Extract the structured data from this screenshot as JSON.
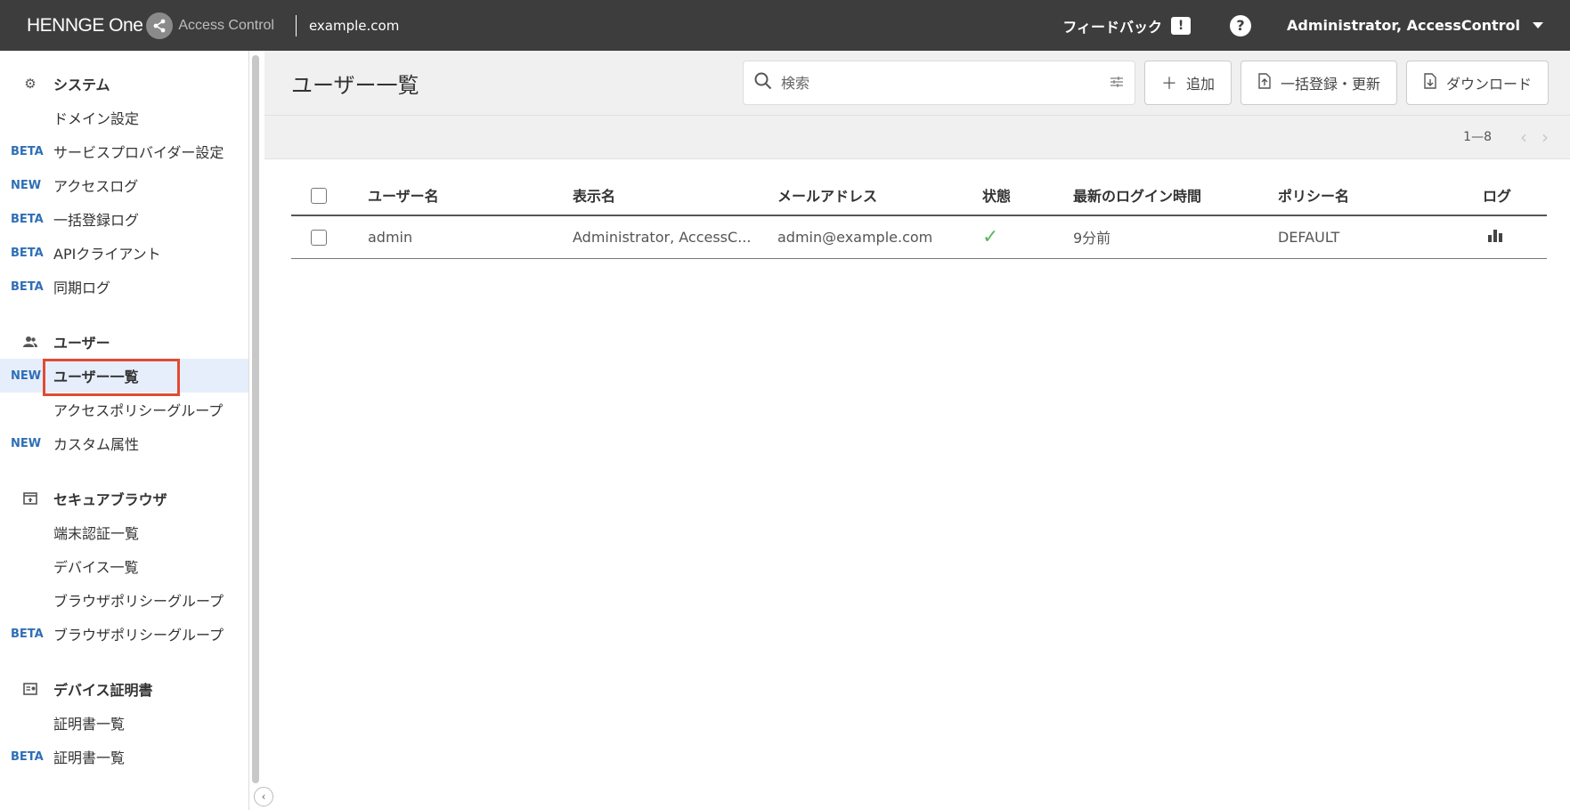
{
  "topbar": {
    "brand": "HENNGE One",
    "product": "Access Control",
    "domain": "example.com",
    "feedback_label": "フィードバック",
    "help_label": "?",
    "user_name": "Administrator, AccessControl"
  },
  "sidebar": {
    "sections": [
      {
        "title": "システム",
        "icon": "gear-icon",
        "items": [
          {
            "badge": "",
            "label": "ドメイン設定"
          },
          {
            "badge": "BETA",
            "label": "サービスプロバイダー設定"
          },
          {
            "badge": "NEW",
            "label": "アクセスログ"
          },
          {
            "badge": "BETA",
            "label": "一括登録ログ"
          },
          {
            "badge": "BETA",
            "label": "APIクライアント"
          },
          {
            "badge": "BETA",
            "label": "同期ログ"
          }
        ]
      },
      {
        "title": "ユーザー",
        "icon": "users-icon",
        "items": [
          {
            "badge": "NEW",
            "label": "ユーザー一覧",
            "active": true
          },
          {
            "badge": "",
            "label": "アクセスポリシーグループ"
          },
          {
            "badge": "NEW",
            "label": "カスタム属性"
          }
        ]
      },
      {
        "title": "セキュアブラウザ",
        "icon": "browser-icon",
        "items": [
          {
            "badge": "",
            "label": "端末認証一覧"
          },
          {
            "badge": "",
            "label": "デバイス一覧"
          },
          {
            "badge": "",
            "label": "ブラウザポリシーグループ"
          },
          {
            "badge": "BETA",
            "label": "ブラウザポリシーグループ"
          }
        ]
      },
      {
        "title": "デバイス証明書",
        "icon": "certificate-icon",
        "items": [
          {
            "badge": "",
            "label": "証明書一覧"
          },
          {
            "badge": "BETA",
            "label": "証明書一覧"
          }
        ]
      }
    ]
  },
  "main": {
    "title": "ユーザー一覧",
    "search_placeholder": "検索",
    "add_label": "追加",
    "bulk_label": "一括登録・更新",
    "download_label": "ダウンロード",
    "pagination": "1—8"
  },
  "table": {
    "headers": [
      "ユーザー名",
      "表示名",
      "メールアドレス",
      "状態",
      "最新のログイン時間",
      "ポリシー名",
      "ログ"
    ],
    "rows": [
      {
        "username": "admin",
        "display_name": "Administrator, AccessC...",
        "email": "admin@example.com",
        "status_icon": "check-icon",
        "last_login": "9分前",
        "policy": "DEFAULT",
        "log_icon": "bar-chart-icon"
      }
    ]
  },
  "colors": {
    "topbar": "#3d3d3d",
    "accent_badge": "#2f6fb5",
    "active_bg": "#e6eefb",
    "highlight": "#e04b32",
    "status_ok": "#5cb85c"
  }
}
